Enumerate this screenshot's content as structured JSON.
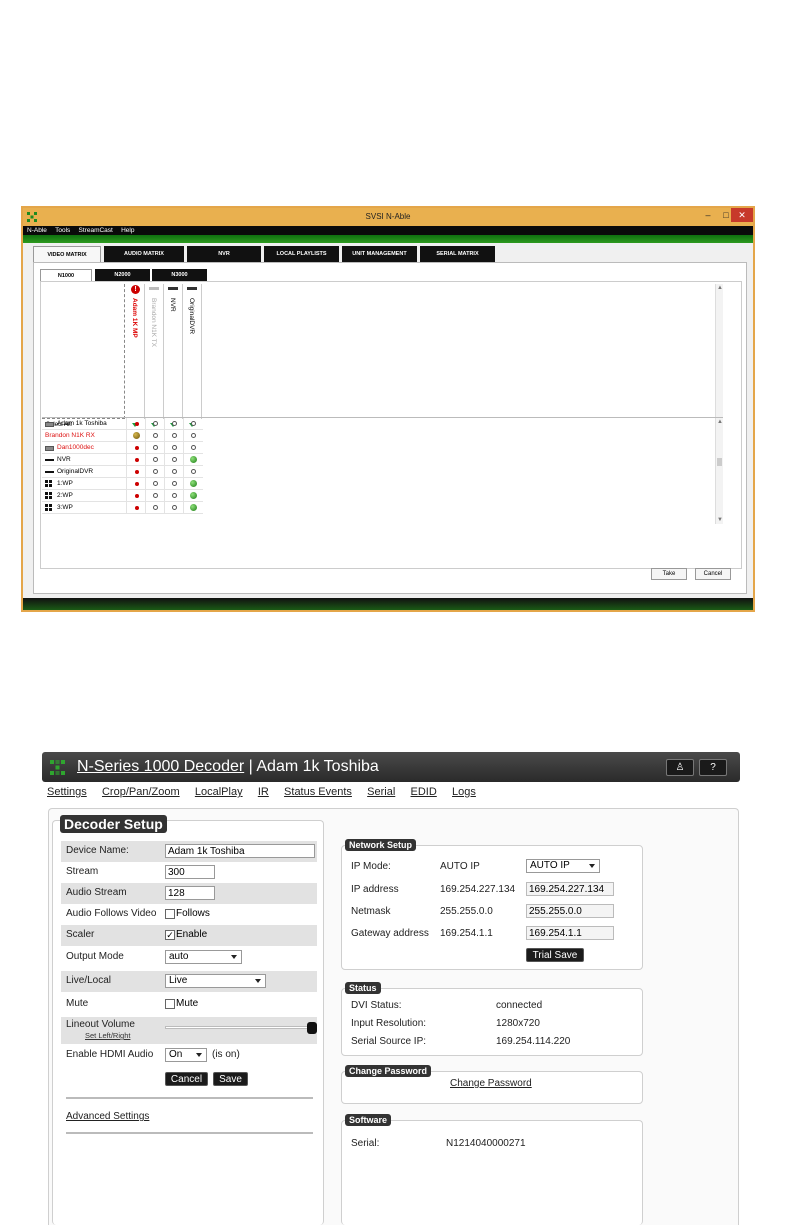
{
  "nable": {
    "window_title": "SVSI N-Able",
    "window_controls": [
      "–",
      "□",
      "✕"
    ],
    "menu": [
      "N-Able",
      "Tools",
      "StreamCast",
      "Help"
    ],
    "main_tabs": [
      "VIDEO MATRIX",
      "AUDIO MATRIX",
      "NVR",
      "LOCAL PLAYLISTS",
      "UNIT MANAGEMENT",
      "SERIAL MATRIX"
    ],
    "active_main_tab": "VIDEO MATRIX",
    "sub_tabs": [
      "N1000",
      "N2000",
      "N3000"
    ],
    "active_sub_tab": "N1000",
    "columns": [
      {
        "label": "Adam 1K MP",
        "style": "red",
        "icon": "alert-icon"
      },
      {
        "label": "Brandon N1K TX",
        "style": "grey",
        "icon": "device-icon"
      },
      {
        "label": "NVR",
        "style": "normal",
        "icon": "device-icon"
      },
      {
        "label": "OriginalDVR",
        "style": "normal",
        "icon": "device-icon"
      }
    ],
    "select_all_label": "Select All:",
    "rows": [
      {
        "label": "Adam 1k Toshiba",
        "icon": "monitor-icon",
        "red": false,
        "cells": [
          "red",
          "empty",
          "empty",
          "empty"
        ]
      },
      {
        "label": "Brandon N1K RX",
        "icon": "none",
        "red": true,
        "cells": [
          "olive",
          "empty",
          "empty",
          "empty"
        ]
      },
      {
        "label": "Dan1000dec",
        "icon": "monitor-icon",
        "red": true,
        "cells": [
          "red",
          "empty",
          "empty",
          "empty"
        ]
      },
      {
        "label": "NVR",
        "icon": "bar-icon",
        "red": false,
        "cells": [
          "red",
          "empty",
          "empty",
          "green"
        ]
      },
      {
        "label": "OriginalDVR",
        "icon": "bar-icon",
        "red": false,
        "cells": [
          "red",
          "empty",
          "empty",
          "empty"
        ]
      },
      {
        "label": "1:WP",
        "icon": "grid-icon",
        "red": false,
        "cells": [
          "red",
          "empty",
          "empty",
          "green"
        ]
      },
      {
        "label": "2:WP",
        "icon": "grid-icon",
        "red": false,
        "cells": [
          "red",
          "empty",
          "empty",
          "green"
        ]
      },
      {
        "label": "3:WP",
        "icon": "grid-icon",
        "red": false,
        "cells": [
          "red",
          "empty",
          "empty",
          "green"
        ]
      }
    ],
    "take_label": "Take",
    "cancel_label": "Cancel"
  },
  "decoder": {
    "title_link": "N-Series 1000 Decoder",
    "title_sep": " | ",
    "title_device": "Adam 1k Toshiba",
    "btn_user": "♙",
    "btn_help": "?",
    "nav": [
      "Settings",
      "Crop/Pan/Zoom",
      "LocalPlay",
      "IR",
      "Status Events",
      "Serial",
      "EDID",
      "Logs"
    ],
    "setup": {
      "legend": "Decoder Setup",
      "device_name_label": "Device Name:",
      "device_name_value": "Adam 1k Toshiba",
      "stream_label": "Stream",
      "stream_value": "300",
      "audio_stream_label": "Audio Stream",
      "audio_stream_value": "128",
      "audio_follows_label": "Audio Follows Video",
      "audio_follows_check": "Follows",
      "scaler_label": "Scaler",
      "scaler_check": "Enable",
      "output_mode_label": "Output Mode",
      "output_mode_value": "auto",
      "live_local_label": "Live/Local",
      "live_local_value": "Live",
      "mute_label": "Mute",
      "mute_check": "Mute",
      "lineout_label": "Lineout Volume",
      "lineout_sub": "Set Left/Right",
      "lineout_level": 1.0,
      "hdmi_audio_label": "Enable HDMI Audio",
      "hdmi_audio_value": "On",
      "hdmi_audio_state": "(is on)",
      "cancel_label": "Cancel",
      "save_label": "Save",
      "advanced_label": "Advanced Settings"
    },
    "network": {
      "legend": "Network Setup",
      "ip_mode_label": "IP Mode:",
      "ip_mode_value": "AUTO IP",
      "ip_mode_select": "AUTO IP",
      "ip_label": "IP address",
      "ip_value": "169.254.227.134",
      "ip_field": "169.254.227.134",
      "netmask_label": "Netmask",
      "netmask_value": "255.255.0.0",
      "netmask_field": "255.255.0.0",
      "gateway_label": "Gateway address",
      "gateway_value": "169.254.1.1",
      "gateway_field": "169.254.1.1",
      "trial_save_label": "Trial Save"
    },
    "status": {
      "legend": "Status",
      "dvi_label": "DVI Status:",
      "dvi_value": "connected",
      "res_label": "Input Resolution:",
      "res_value": "1280x720",
      "serial_ip_label": "Serial Source IP:",
      "serial_ip_value": "169.254.114.220"
    },
    "password": {
      "legend": "Change Password",
      "link": "Change Password"
    },
    "software": {
      "legend": "Software",
      "serial_label": "Serial:",
      "serial_value": "N1214040000271"
    }
  }
}
